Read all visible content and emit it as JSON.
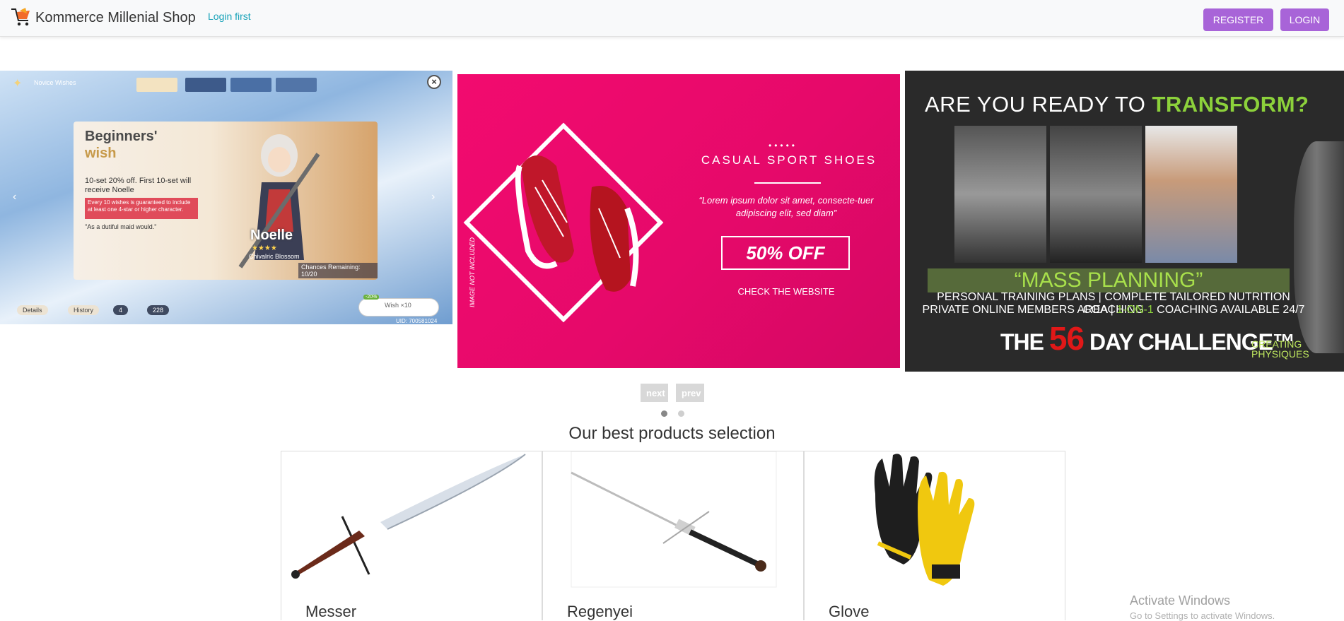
{
  "navbar": {
    "brand": "Kommerce Millenial Shop",
    "login_first": "Login first",
    "register_label": "REGISTER",
    "login_label": "LOGIN"
  },
  "carousel": {
    "slides": [
      {
        "title": "Beginners'",
        "subtitle": "wish",
        "event_label": "Novice Wishes",
        "description": "10-set 20% off. First 10-set will receive Noelle",
        "highlight": "Every 10 wishes is guaranteed to include at least one 4-star or higher character.",
        "quote": "\"As a dutiful maid would.\"",
        "character": "Noelle",
        "character_sub": "Chivalric Blossom",
        "chances": "Chances Remaining: 10/20",
        "details": "Details",
        "history": "History",
        "count_a": "4",
        "count_b": "228",
        "wish_label": "Wish ×10",
        "discount_badge": "-20%",
        "uid": "UID: 700581024"
      },
      {
        "title": "CASUAL SPORT SHOES",
        "lorem": "“Lorem ipsum dolor sit amet, consecte-tuer adipiscing elit, sed diam”",
        "offer": "50% OFF",
        "cta": "CHECK THE WEBSITE",
        "note": "IMAGE NOT INCLUDED"
      },
      {
        "headline_a": "ARE YOU READY TO ",
        "headline_b": "TRANSFORM",
        "headline_c": "?",
        "mass": "“MASS PLANNING”",
        "line1": "PERSONAL TRAINING PLANS | COMPLETE TAILORED NUTRITION COACHING",
        "line2_a": "PRIVATE ONLINE MEMBERS AREA | ",
        "line2_b": "1-ON-1",
        "line2_c": " COACHING AVAILABLE 24/7",
        "challenge_a": "THE ",
        "challenge_b": "56",
        "challenge_c": " DAY CHALLENGE™",
        "brand_a": "CREATING",
        "brand_b": "PHYSIQUES"
      }
    ],
    "next_label": "next",
    "prev_label": "prev",
    "active_dot": 1
  },
  "section_title": "Our best products selection",
  "products": [
    {
      "name": "Messer"
    },
    {
      "name": "Regenyei"
    },
    {
      "name": "Glove"
    }
  ],
  "watermark": {
    "title": "Activate Windows",
    "subtitle": "Go to Settings to activate Windows."
  },
  "colors": {
    "brand_button": "#a864d8",
    "link": "#17a2b8",
    "slide2_bg": "#f20b6f",
    "slide3_accent": "#8cd13b"
  }
}
